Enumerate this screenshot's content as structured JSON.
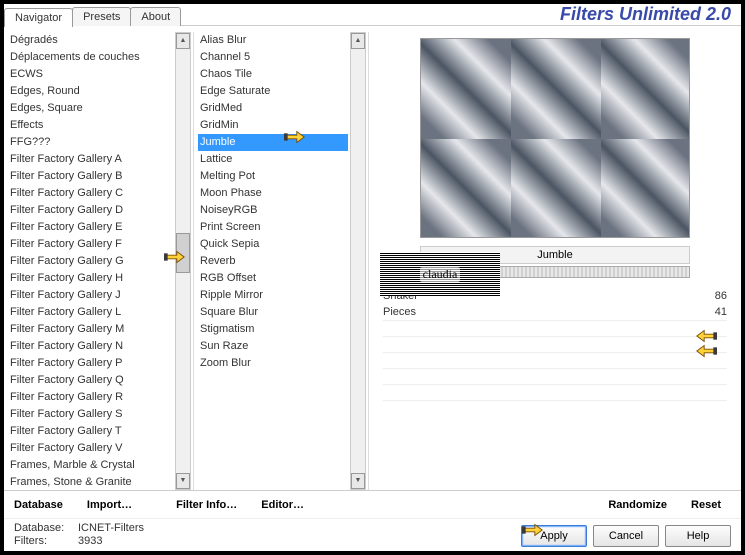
{
  "header": {
    "title": "Filters Unlimited 2.0",
    "tabs": [
      "Navigator",
      "Presets",
      "About"
    ],
    "active_tab": 0
  },
  "categories": {
    "items": [
      "Dégradés",
      "Déplacements de couches",
      "ECWS",
      "Edges, Round",
      "Edges, Square",
      "Effects",
      "FFG???",
      "Filter Factory Gallery A",
      "Filter Factory Gallery B",
      "Filter Factory Gallery C",
      "Filter Factory Gallery D",
      "Filter Factory Gallery E",
      "Filter Factory Gallery F",
      "Filter Factory Gallery G",
      "Filter Factory Gallery H",
      "Filter Factory Gallery J",
      "Filter Factory Gallery L",
      "Filter Factory Gallery M",
      "Filter Factory Gallery N",
      "Filter Factory Gallery P",
      "Filter Factory Gallery Q",
      "Filter Factory Gallery R",
      "Filter Factory Gallery S",
      "Filter Factory Gallery T",
      "Filter Factory Gallery V",
      "Frames, Marble & Crystal",
      "Frames, Stone & Granite"
    ],
    "selected_index": 14,
    "highlighted_index": 14
  },
  "filters": {
    "items": [
      "Alias Blur",
      "Channel 5",
      "Chaos Tile",
      "Edge Saturate",
      "GridMed",
      "GridMin",
      "Jumble",
      "Lattice",
      "Melting Pot",
      "Moon Phase",
      "NoiseyRGB",
      "Print Screen",
      "Quick Sepia",
      "Reverb",
      "RGB Offset",
      "Ripple Mirror",
      "Square Blur",
      "Stigmatism",
      "Sun Raze",
      "Zoom Blur"
    ],
    "selected_index": 6
  },
  "right_panel": {
    "current_filter": "Jumble",
    "params": [
      {
        "name": "Shaker",
        "value": 86
      },
      {
        "name": "Pieces",
        "value": 41
      }
    ],
    "watermark": "claudia"
  },
  "toolbar": {
    "database": "Database",
    "import": "Import…",
    "filter_info": "Filter Info…",
    "editor": "Editor…",
    "randomize": "Randomize",
    "reset": "Reset"
  },
  "status": {
    "db_label": "Database:",
    "db_value": "ICNET-Filters",
    "filters_label": "Filters:",
    "filters_value": "3933"
  },
  "buttons": {
    "apply": "Apply",
    "cancel": "Cancel",
    "help": "Help"
  }
}
